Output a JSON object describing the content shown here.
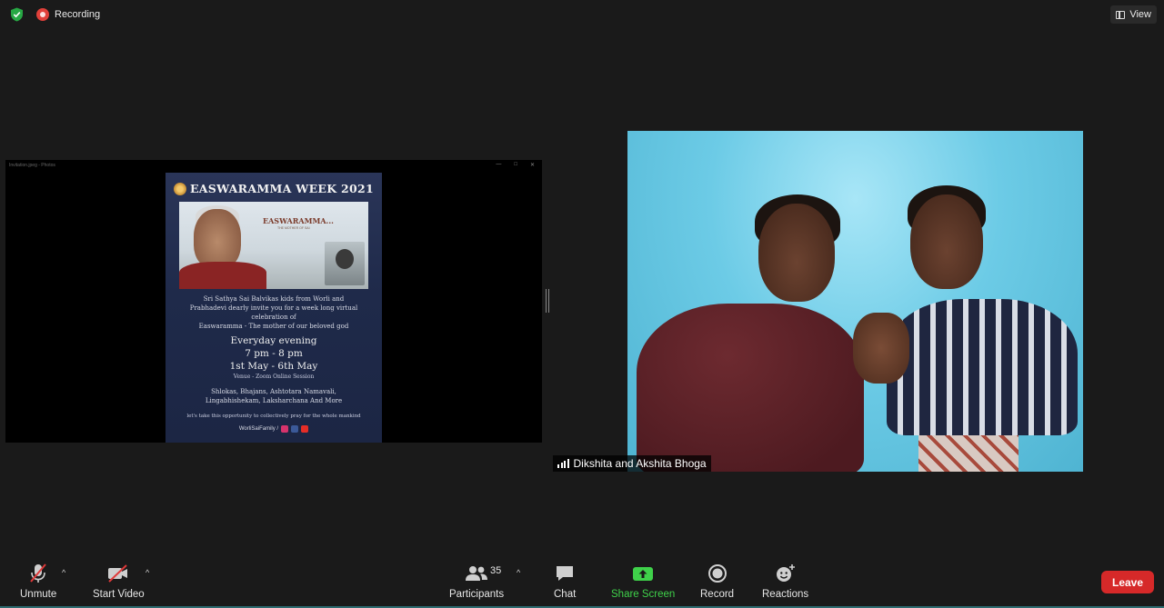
{
  "topbar": {
    "recording_label": "Recording",
    "view_label": "View"
  },
  "share": {
    "window_title": "Invitation.jpeg - Photos",
    "poster": {
      "title": "EASWARAMMA WEEK 2021",
      "photo_caption": "EASWARAMMA...",
      "photo_sub": "THE MOTHER OF SAI",
      "invite_lines": [
        "Sri Sathya Sai Balvikas kids from Worli and",
        "Prabhadevi dearly invite you for a week long virtual",
        "celebration of",
        "Easwaramma - The mother of our beloved god"
      ],
      "schedule_line1": "Everyday evening",
      "schedule_line2": "7 pm - 8 pm",
      "schedule_line3": "1st May - 6th May",
      "venue": "Venue - Zoom Online Session",
      "program_lines": [
        "Shlokas, Bhajans, Ashtotara Namavali,",
        "Lingabhishekam, Laksharchana And More"
      ],
      "prayer_text": "let's take this opportunity to collectively pray for the whole mankind",
      "footer_handle": "WorliSaiFamily /"
    }
  },
  "video": {
    "participant_name": "Dikshita and Akshita  Bhoga"
  },
  "toolbar": {
    "unmute_label": "Unmute",
    "start_video_label": "Start Video",
    "participants_label": "Participants",
    "participants_count": "35",
    "chat_label": "Chat",
    "share_screen_label": "Share Screen",
    "record_label": "Record",
    "reactions_label": "Reactions",
    "leave_label": "Leave"
  },
  "colors": {
    "background": "#1a1a1a",
    "share_accent": "#3fd14a",
    "leave_red": "#d62929",
    "recording_red": "#e0403a"
  },
  "icons": [
    "shield-icon",
    "recording-icon",
    "view-icon",
    "microphone-muted-icon",
    "video-off-icon",
    "participants-icon",
    "chat-icon",
    "share-screen-icon",
    "record-icon",
    "reactions-icon",
    "signal-bars-icon"
  ]
}
